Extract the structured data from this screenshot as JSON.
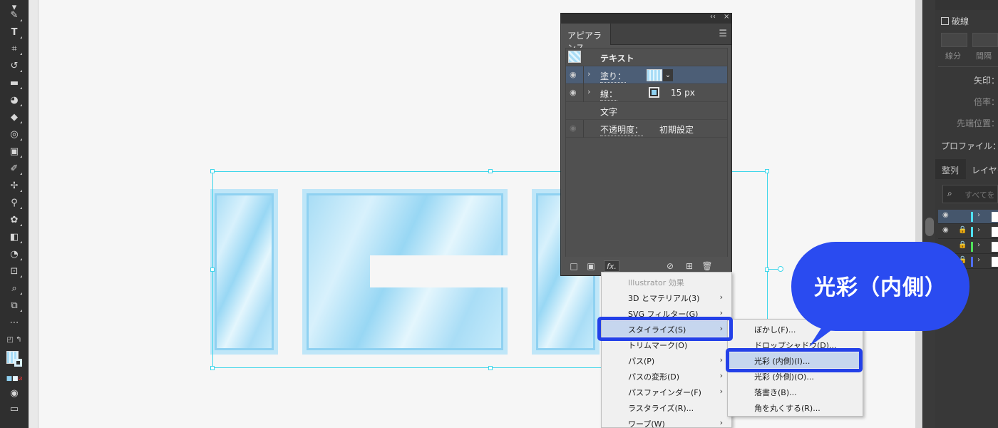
{
  "appearance_panel": {
    "tab_label": "アピアランス",
    "collapse_glyph": "‹‹",
    "close_glyph": "×",
    "object_label": "テキスト",
    "rows": {
      "fill": {
        "label": "塗り："
      },
      "stroke": {
        "label": "線：",
        "value": "15 px"
      },
      "characters": {
        "label": "文字"
      },
      "opacity": {
        "label": "不透明度：",
        "value": "初期設定"
      }
    },
    "fx_label": "fx."
  },
  "effect_menu": {
    "items": [
      {
        "label": "Illustrator 効果"
      },
      {
        "label": "3D とマテリアル(3)"
      },
      {
        "label": "SVG フィルター(G)"
      },
      {
        "label": "スタイライズ(S)"
      },
      {
        "label": "トリムマーク(O)"
      },
      {
        "label": "パス(P)"
      },
      {
        "label": "パスの変形(D)"
      },
      {
        "label": "パスファインダー(F)"
      },
      {
        "label": "ラスタライズ(R)..."
      },
      {
        "label": "ワープ(W)"
      }
    ]
  },
  "stylize_submenu": {
    "items": [
      {
        "label": "ぼかし(F)..."
      },
      {
        "label": "ドロップシャドウ(D)..."
      },
      {
        "label": "光彩 (内側)(I)..."
      },
      {
        "label": "光彩 (外側)(O)..."
      },
      {
        "label": "落書き(B)..."
      },
      {
        "label": "角を丸くする(R)..."
      }
    ]
  },
  "callout": {
    "text": "光彩（内側）"
  },
  "right_dock": {
    "dashed_checkbox": "破線",
    "btn_segment": "線分",
    "btn_gap": "間隔",
    "arrow_label": "矢印：",
    "scale_label": "倍率：",
    "tip_position_label": "先端位置：",
    "profile_label": "プロファイル：",
    "tab_align": "整列",
    "tab_layers": "レイヤー",
    "search_placeholder": "すべてを"
  },
  "colors": {
    "callout_blue": "#2a4bf0",
    "highlight_frame": "#2340e8",
    "selection_cyan": "#3fd6ea",
    "panel_bg": "#535353",
    "menu_bg": "#f0f0f0"
  }
}
